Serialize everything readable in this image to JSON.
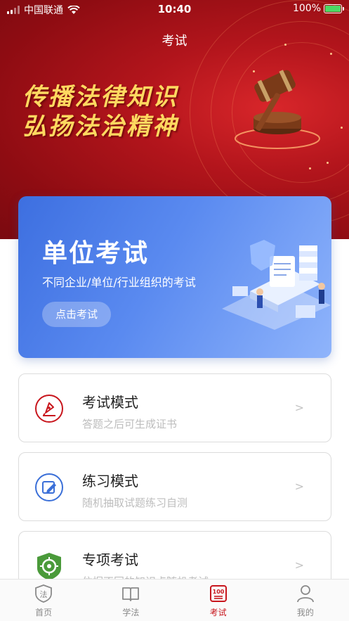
{
  "status_bar": {
    "carrier": "中国联通",
    "time": "10:40",
    "battery": "100%"
  },
  "header": {
    "title": "考试"
  },
  "hero": {
    "slogan_line1": "传播法律知识",
    "slogan_line2": "弘扬法治精神"
  },
  "exam_card": {
    "title": "单位考试",
    "subtitle": "不同企业/单位/行业组织的考试",
    "button_label": "点击考试"
  },
  "modes": [
    {
      "name": "考试模式",
      "desc": "答题之后可生成证书",
      "icon": "pen-nib-icon",
      "color": "#c8161d"
    },
    {
      "name": "练习模式",
      "desc": "随机抽取试题练习自测",
      "icon": "edit-icon",
      "color": "#3a6fd8"
    },
    {
      "name": "专项考试",
      "desc": "依据不同的知识点随机考试",
      "icon": "target-icon",
      "color": "#4a9a3a"
    }
  ],
  "tabbar": {
    "items": [
      {
        "label": "首页",
        "icon": "law-shield-icon"
      },
      {
        "label": "学法",
        "icon": "book-icon"
      },
      {
        "label": "考试",
        "icon": "exam-100-icon",
        "active": true
      },
      {
        "label": "我的",
        "icon": "person-icon"
      }
    ]
  },
  "colors": {
    "primary_red": "#c8161d",
    "card_blue": "#4a7ce8"
  }
}
